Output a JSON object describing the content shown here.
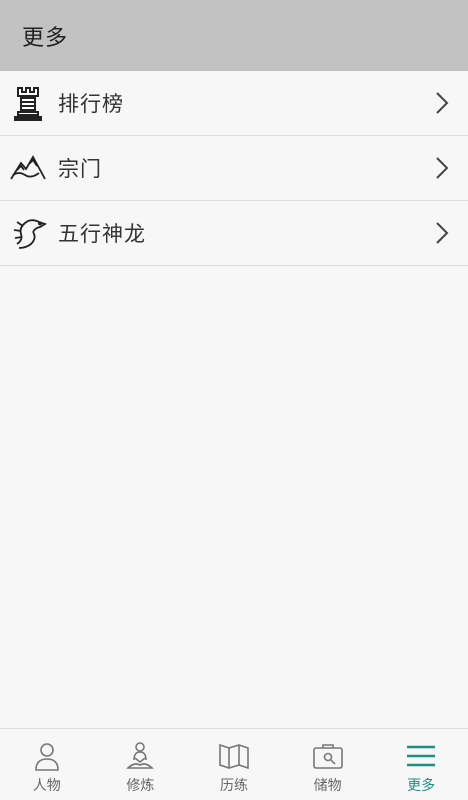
{
  "header": {
    "title": "更多"
  },
  "menu": {
    "items": [
      {
        "label": "排行榜",
        "icon": "rook-icon"
      },
      {
        "label": "宗门",
        "icon": "mountain-icon"
      },
      {
        "label": "五行神龙",
        "icon": "dragon-icon"
      }
    ]
  },
  "tabbar": {
    "active_color": "#1f8f86",
    "inactive_color": "#777777",
    "tabs": [
      {
        "label": "人物",
        "icon": "person-icon"
      },
      {
        "label": "修炼",
        "icon": "meditation-icon"
      },
      {
        "label": "历练",
        "icon": "map-icon"
      },
      {
        "label": "储物",
        "icon": "bag-icon"
      },
      {
        "label": "更多",
        "icon": "menu-icon",
        "active": true
      }
    ]
  }
}
